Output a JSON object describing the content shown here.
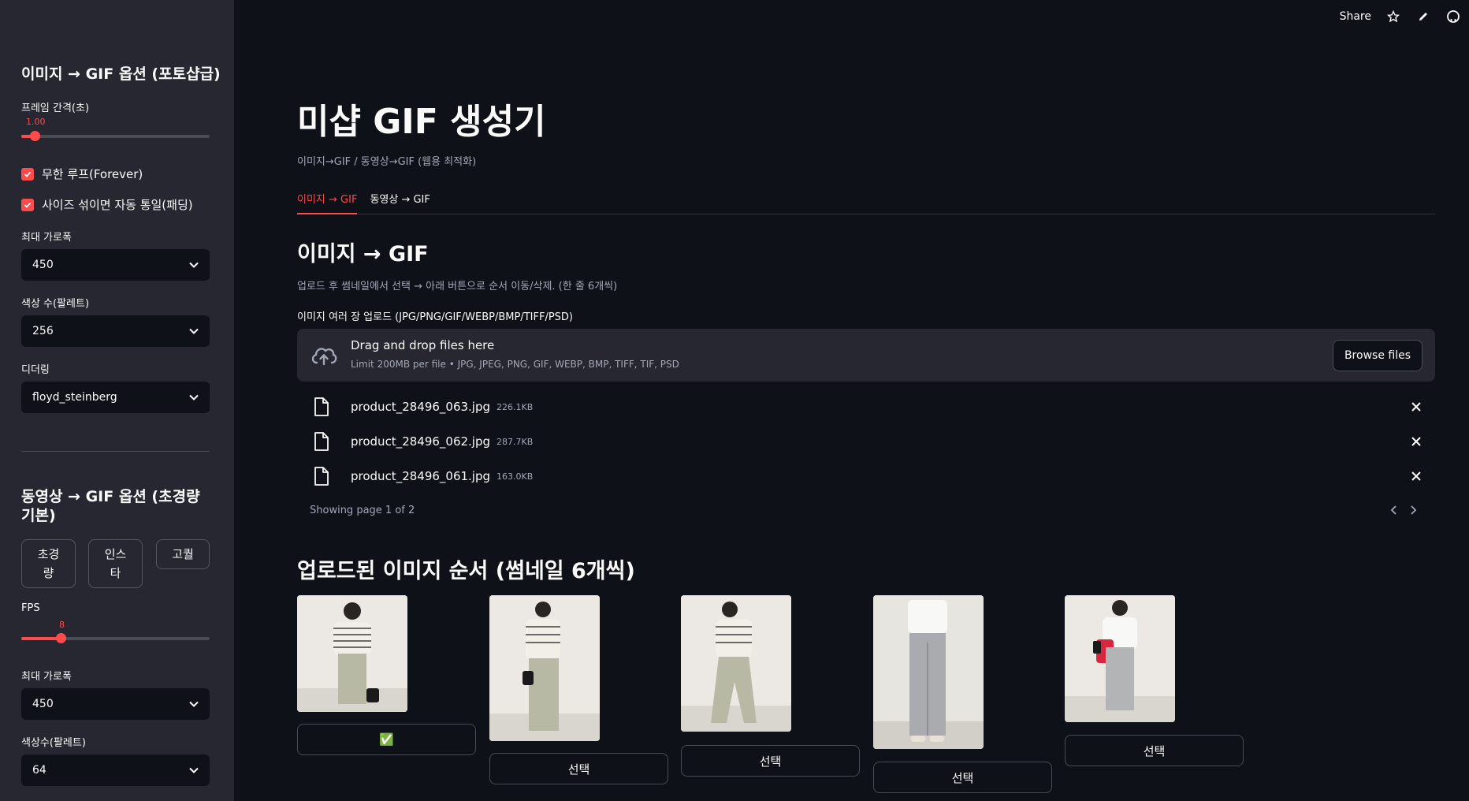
{
  "topbar": {
    "share_label": "Share",
    "icons": [
      "star-icon",
      "pencil-icon",
      "github-icon"
    ]
  },
  "sidebar": {
    "image_section_title": "이미지 → GIF 옵션 (포토샵급)",
    "frame_interval_label": "프레임 간격(초)",
    "frame_interval_value": "1.00",
    "frame_interval_fraction": 0.07,
    "loop_label": "무한 루프(Forever)",
    "loop_checked": true,
    "pad_label": "사이즈 섞이면 자동 통일(패딩)",
    "pad_checked": true,
    "max_width_label": "최대 가로폭",
    "max_width_value": "450",
    "colors_label": "색상 수(팔레트)",
    "colors_value": "256",
    "dither_label": "디더링",
    "dither_value": "floyd_steinberg",
    "video_section_title": "동영상 → GIF 옵션 (초경량 기본)",
    "presets": [
      "초경\n량",
      "인스\n타",
      "고퀄"
    ],
    "fps_label": "FPS",
    "fps_value": "8",
    "fps_fraction": 0.21,
    "v_max_width_label": "최대 가로폭",
    "v_max_width_value": "450",
    "v_colors_label": "색상수(팔레트)",
    "v_colors_value": "64"
  },
  "main": {
    "title": "미샵 GIF 생성기",
    "caption": "이미지→GIF / 동영상→GIF (웹용 최적화)",
    "tabs": [
      "이미지 → GIF",
      "동영상 → GIF"
    ],
    "active_tab": 0,
    "section_title": "이미지 → GIF",
    "section_desc": "업로드 후 썸네일에서 선택 → 아래 버튼으로 순서 이동/삭제. (한 줄 6개씩)",
    "upload_label": "이미지 여러 장 업로드 (JPG/PNG/GIF/WEBP/BMP/TIFF/PSD)",
    "dropzone_title": "Drag and drop files here",
    "dropzone_limit": "Limit 200MB per file • JPG, JPEG, PNG, GIF, WEBP, BMP, TIFF, TIF, PSD",
    "browse_label": "Browse files",
    "files": [
      {
        "name": "product_28496_063.jpg",
        "size": "226.1KB"
      },
      {
        "name": "product_28496_062.jpg",
        "size": "287.7KB"
      },
      {
        "name": "product_28496_061.jpg",
        "size": "163.0KB"
      }
    ],
    "page_info": "Showing page 1 of 2",
    "order_title": "업로드된 이미지 순서 (썸네일 6개씩)",
    "select_label": "선택",
    "selected_mark": "✅"
  }
}
